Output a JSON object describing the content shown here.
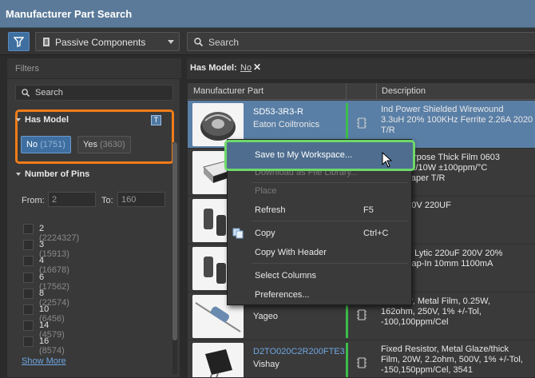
{
  "window": {
    "title": "Manufacturer Part Search"
  },
  "toolbar": {
    "category": "Passive Components",
    "search_placeholder": "Search"
  },
  "filters": {
    "header": "Filters",
    "search_placeholder": "Search",
    "has_model": {
      "title": "Has Model",
      "badge": "T",
      "options": [
        {
          "label": "No",
          "count": "(1751)",
          "selected": true
        },
        {
          "label": "Yes",
          "count": "(3630)",
          "selected": false
        }
      ]
    },
    "pins": {
      "title": "Number of Pins",
      "from_label": "From:",
      "from_value": "2",
      "to_label": "To:",
      "to_value": "160",
      "items": [
        {
          "value": "2",
          "count": "(2224327)"
        },
        {
          "value": "3",
          "count": "(15913)"
        },
        {
          "value": "4",
          "count": "(16678)"
        },
        {
          "value": "6",
          "count": "(17562)"
        },
        {
          "value": "8",
          "count": "(22574)"
        },
        {
          "value": "10",
          "count": "(6456)"
        },
        {
          "value": "14",
          "count": "(4579)"
        },
        {
          "value": "16",
          "count": "(8574)"
        }
      ],
      "show_more": "Show More"
    }
  },
  "active_filter": {
    "key": "Has Model:",
    "value": "No",
    "remove": "✕"
  },
  "grid": {
    "columns": [
      "Manufacturer Part",
      "Description"
    ],
    "rows": [
      {
        "mpn": "SD53-3R3-R",
        "mfr": "Eaton Coiltronics",
        "desc": "Ind Power Shielded Wirewound\n3.3uH 20% 100KHz Ferrite 2.26A 2020\nT/R",
        "selected": true
      },
      {
        "mpn": "",
        "mfr": "",
        "desc": "neral Purpose Thick Film 0603\nhm 1% 1/10W ±100ppm/°C\n SMD Paper T/R",
        "selected": false
      },
      {
        "mpn": "",
        "mfr": "",
        "desc": "TOR 400V 220UF",
        "selected": false
      },
      {
        "mpn": "",
        "mfr": "",
        "desc": "uminum Lytic 220uF 200V 20%\nmm) Snap-In 10mm 1100mA\n5C Bulk",
        "selected": false
      },
      {
        "mpn": "",
        "mfr": "Yageo",
        "desc": "Resistor, Metal Film, 0.25W,\n162ohm, 250V, 1% +/-Tol,\n-100,100ppm/Cel",
        "selected": false
      },
      {
        "mpn": "D2TO020C2R200FTE3",
        "mfr": "Vishay",
        "desc": "Fixed Resistor, Metal Glaze/thick\nFilm, 20W, 2.2ohm, 500V, 1% +/-Tol,\n-150,150ppm/Cel, 3541",
        "selected": false
      }
    ]
  },
  "context_menu": {
    "items": [
      {
        "label": "Save to My Workspace...",
        "shortcut": "",
        "enabled": true,
        "highlighted": true
      },
      {
        "label": "Download as File Library...",
        "shortcut": "",
        "enabled": false
      },
      {
        "label": "Place",
        "shortcut": "",
        "enabled": false
      },
      {
        "label": "Refresh",
        "shortcut": "F5",
        "enabled": true
      },
      {
        "label": "Copy",
        "shortcut": "Ctrl+C",
        "enabled": true
      },
      {
        "label": "Copy With Header",
        "shortcut": "",
        "enabled": true
      },
      {
        "label": "Select Columns",
        "shortcut": "",
        "enabled": true
      },
      {
        "label": "Preferences...",
        "shortcut": "",
        "enabled": true
      }
    ]
  },
  "colors": {
    "accent": "#3f6fa0",
    "highlight_box": "#f07c1a",
    "menu_highlight_box": "#6ed86a",
    "model_bar": "#3dbd4a"
  }
}
